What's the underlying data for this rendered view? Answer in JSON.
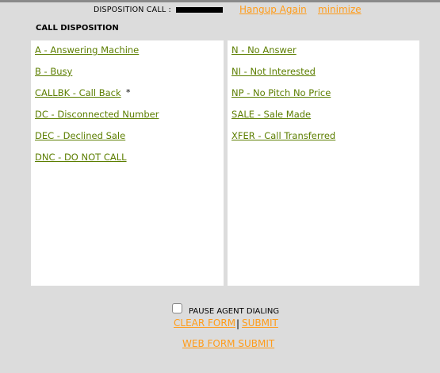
{
  "header": {
    "title": "DISPOSITION CALL :",
    "hangup": "Hangup Again",
    "minimize": "minimize"
  },
  "section_title": "CALL DISPOSITION",
  "left_options": [
    "A - Answering Machine",
    "B - Busy",
    "CALLBK - Call Back",
    "DC - Disconnected Number",
    "DEC - Declined Sale",
    "DNC - DO NOT CALL"
  ],
  "callback_marker": "*",
  "right_options": [
    "N - No Answer",
    "NI - Not Interested",
    "NP - No Pitch No Price",
    "SALE - Sale Made",
    "XFER - Call Transferred"
  ],
  "footer": {
    "pause_label": "PAUSE AGENT DIALING",
    "pause_checked": false,
    "clear_form": "CLEAR FORM",
    "separator": "|",
    "submit": "SUBMIT",
    "web_form_submit": "WEB FORM SUBMIT"
  },
  "colors": {
    "background": "#dcdcdc",
    "link_green": "#5c7e00",
    "link_orange": "#ff9c1a",
    "panel": "#ffffff"
  }
}
